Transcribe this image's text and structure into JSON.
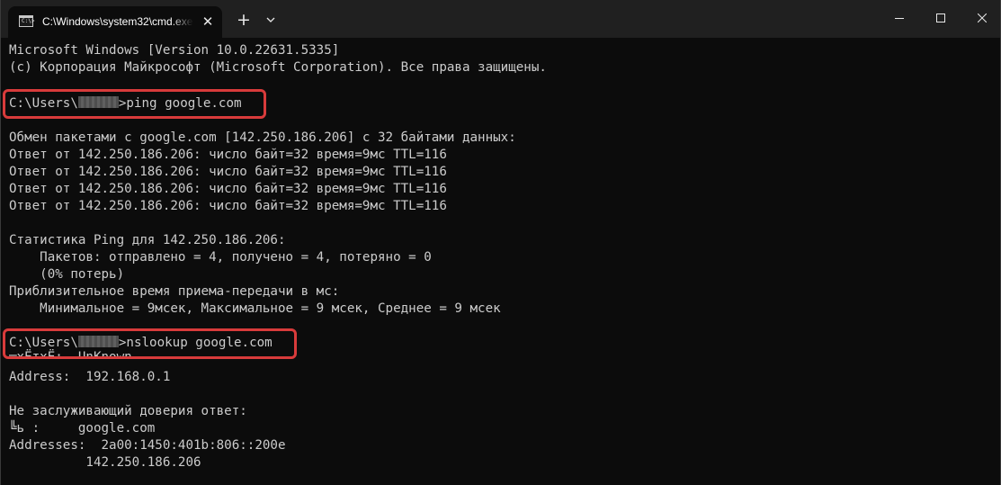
{
  "window": {
    "tab_title": "C:\\Windows\\system32\\cmd.exe",
    "tab_icon_glyph": "C:\\>",
    "close_tab_glyph": "✕",
    "new_tab_glyph": "+",
    "icons": {
      "tab": "cmd-icon",
      "close": "close-icon",
      "new_tab": "plus-icon",
      "dropdown": "chevron-down-icon",
      "minimize": "minimize-icon",
      "maximize": "maximize-icon",
      "window_close": "close-icon"
    }
  },
  "colors": {
    "console_bg": "#0c0c0c",
    "titlebar_bg": "#202020",
    "text": "#cccccc",
    "highlight": "#d83b3b"
  },
  "console": {
    "header": [
      "Microsoft Windows [Version 10.0.22631.5335]",
      "(c) Корпорация Майкрософт (Microsoft Corporation). Все права защищены."
    ],
    "prompt_prefix": "C:\\Users\\",
    "ping_command": ">ping google.com",
    "ping_lines": [
      "Обмен пакетами с google.com [142.250.186.206] с 32 байтами данных:",
      "Ответ от 142.250.186.206: число байт=32 время=9мс TTL=116",
      "Ответ от 142.250.186.206: число байт=32 время=9мс TTL=116",
      "Ответ от 142.250.186.206: число байт=32 время=9мс TTL=116",
      "Ответ от 142.250.186.206: число байт=32 время=9мс TTL=116"
    ],
    "stats_lines": [
      "Статистика Ping для 142.250.186.206:",
      "    Пакетов: отправлено = 4, получено = 4, потеряно = 0",
      "    (0% потерь)",
      "Приблизительное время приема-передачи в мс:",
      "    Минимальное = 9мсек, Максимальное = 9 мсек, Среднее = 9 мсек"
    ],
    "nslookup_command": ">nslookup google.com",
    "server_line": "╤хЁтхЁ:  UnKnown",
    "address_line": "Address:  192.168.0.1",
    "nonauth_line": "Не заслуживающий доверия ответ:",
    "name_line": "╚ь :     google.com",
    "addresses_line": "Addresses:  2a00:1450:401b:806::200e",
    "addresses_line2": "          142.250.186.206"
  }
}
